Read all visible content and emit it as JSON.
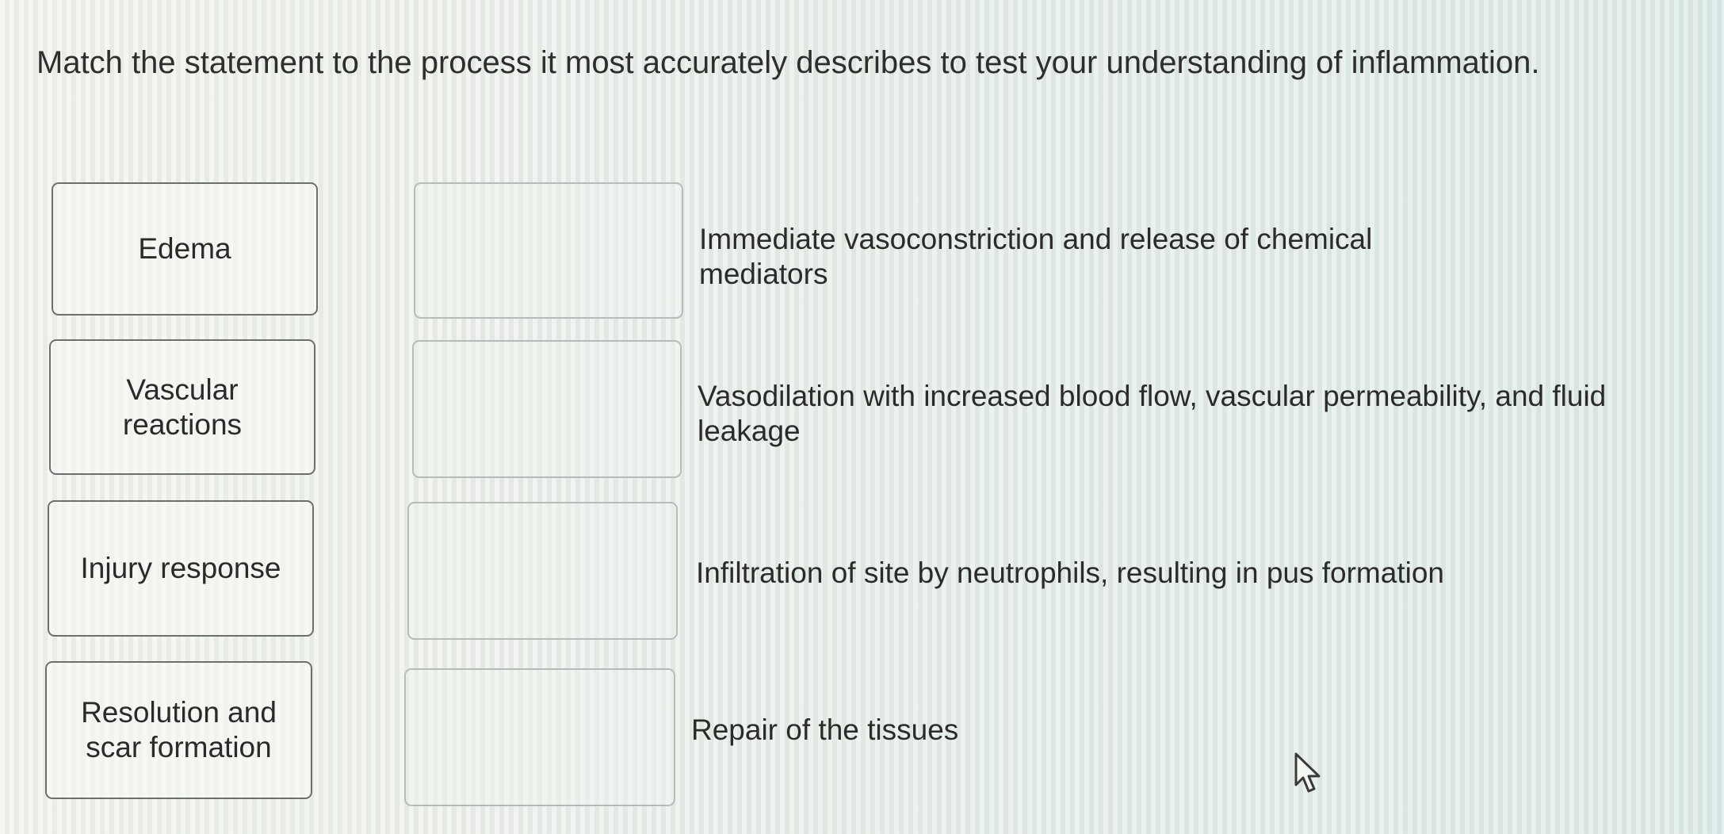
{
  "question": {
    "text": "Match the statement to the process it most accurately describes to test your understanding of inflammation."
  },
  "terms": [
    {
      "label": "Edema"
    },
    {
      "label": "Vascular reactions"
    },
    {
      "label": "Injury response"
    },
    {
      "label": "Resolution and scar formation"
    }
  ],
  "statements": [
    {
      "text": "Immediate vasoconstriction and release of chemical mediators"
    },
    {
      "text": "Vasodilation with increased blood flow, vascular permeability, and fluid leakage"
    },
    {
      "text": "Infiltration of site by neutrophils, resulting in pus formation"
    },
    {
      "text": "Repair of the tissues"
    }
  ],
  "icons": {
    "cursor": "mouse-pointer-icon"
  },
  "colors": {
    "card_border": "#6e6e6e",
    "slot_border": "#b4bdb8",
    "text": "#2b2b2b"
  }
}
